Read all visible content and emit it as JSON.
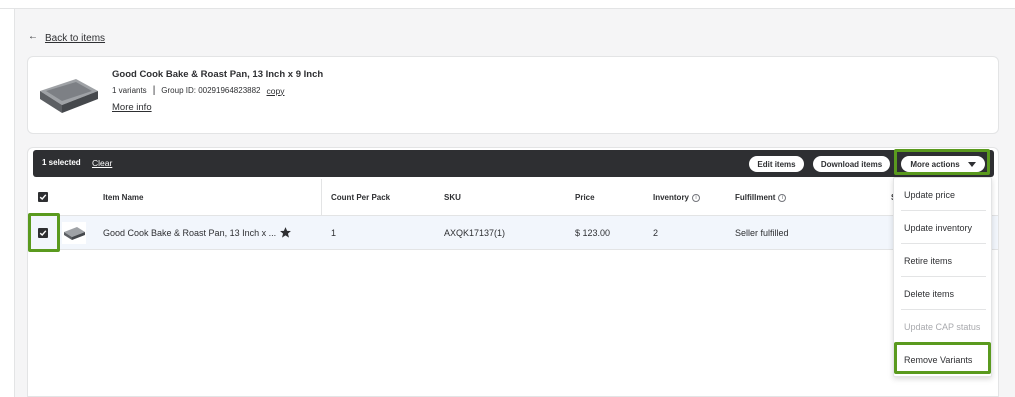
{
  "nav": {
    "back_arrow": "←",
    "back_label": "Back to items"
  },
  "item": {
    "title": "Good Cook Bake & Roast Pan, 13 Inch x 9 Inch",
    "variants": "1 variants",
    "separator": "|",
    "group_id": "Group ID: 00291964823882",
    "copy_label": "copy",
    "more_info": "More info",
    "thumb_icon": "baking-pan-image"
  },
  "action_bar": {
    "selected_count": "1 selected",
    "clear_label": "Clear",
    "edit_items": "Edit items",
    "download_items": "Download items",
    "more_actions": "More actions"
  },
  "table": {
    "headers": {
      "item_name": "Item Name",
      "count_per_pack": "Count Per Pack",
      "sku": "SKU",
      "price": "Price",
      "inventory": "Inventory",
      "fulfillment": "Fulfillment",
      "partial": "S"
    },
    "info_glyph": "i",
    "rows": [
      {
        "checked": true,
        "item_name": "Good Cook Bake & Roast Pan, 13 Inch x ...",
        "count_per_pack": "1",
        "sku": "AXQK17137(1)",
        "price": "$ 123.00",
        "inventory": "2",
        "fulfillment": "Seller fulfilled"
      }
    ]
  },
  "more_actions_menu": [
    {
      "label": "Update price",
      "disabled": false
    },
    {
      "label": "Update inventory",
      "disabled": false
    },
    {
      "label": "Retire items",
      "disabled": false
    },
    {
      "label": "Delete items",
      "disabled": false
    },
    {
      "label": "Update CAP status",
      "disabled": true
    },
    {
      "label": "Remove Variants",
      "disabled": false
    }
  ],
  "colors": {
    "dark_bar": "#2e2f32",
    "highlight": "#5a9a1e",
    "row_selected": "#f2f6fc",
    "disabled_text": "#a9aaae"
  }
}
